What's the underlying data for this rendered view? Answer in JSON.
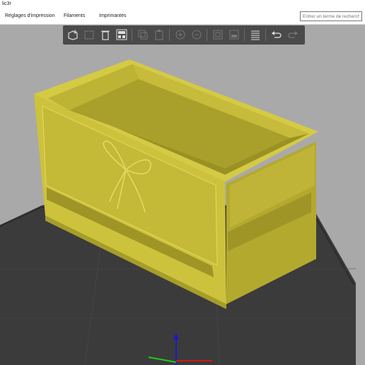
{
  "window": {
    "title": "lic3r"
  },
  "menu": {
    "tabs": [
      {
        "label": "Réglages d'impression"
      },
      {
        "label": "Filaments"
      },
      {
        "label": "Imprimantes"
      }
    ]
  },
  "search": {
    "placeholder": "Entrer un terme de recherche"
  },
  "toolbar": {
    "icons": [
      "add-icon",
      "delete-icon",
      "delete-all-icon",
      "arrange-icon",
      "copy-icon",
      "paste-icon",
      "add-instance-icon",
      "remove-instance-icon",
      "split-objects-icon",
      "split-parts-icon",
      "layers-editing-icon",
      "undo-icon",
      "redo-icon"
    ]
  },
  "colors": {
    "model": "#c8bd3a",
    "bed": "#3a3a3a",
    "background": "#a9a9a9",
    "toolbar": "#4a4a4a"
  }
}
